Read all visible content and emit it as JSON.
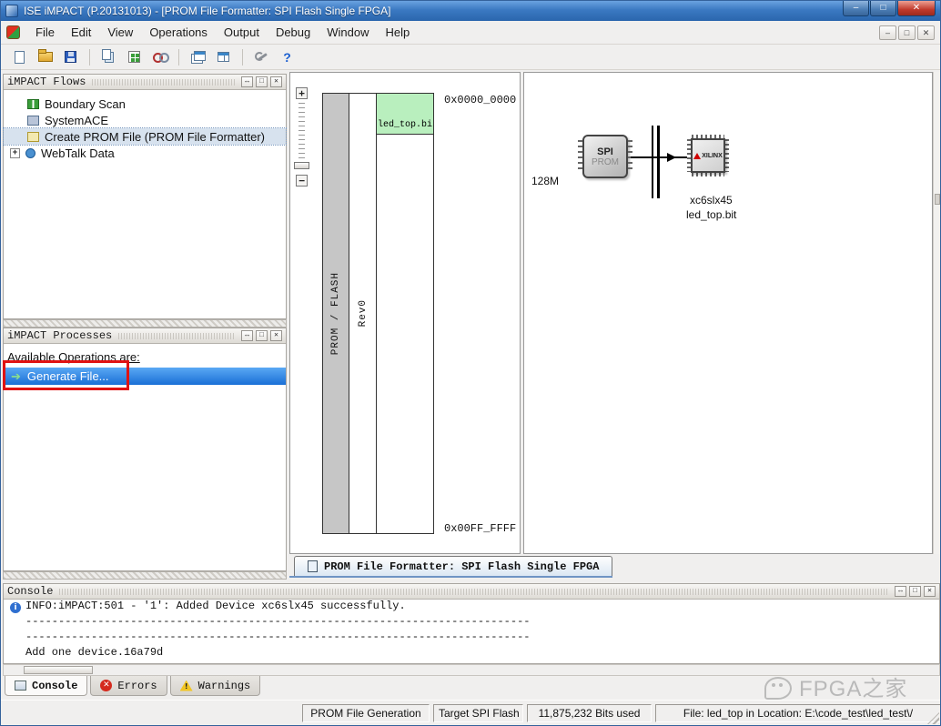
{
  "titlebar": {
    "title": "ISE iMPACT (P.20131013) - [PROM File Formatter: SPI Flash Single FPGA]"
  },
  "menubar": {
    "items": [
      "File",
      "Edit",
      "View",
      "Operations",
      "Output",
      "Debug",
      "Window",
      "Help"
    ]
  },
  "flows_panel": {
    "title": "iMPACT Flows",
    "items": [
      {
        "label": "Boundary Scan"
      },
      {
        "label": "SystemACE"
      },
      {
        "label": "Create PROM File (PROM File Formatter)"
      },
      {
        "label": "WebTalk Data"
      }
    ]
  },
  "processes_panel": {
    "title": "iMPACT Processes",
    "heading": "Available Operations are:",
    "operations": [
      {
        "label": "Generate File..."
      }
    ]
  },
  "prom_view": {
    "flash_label": "PROM / FLASH",
    "rev_label": "Rev0",
    "file_cell": "led_top.bi",
    "address_top": "0x0000_0000",
    "address_bottom": "0x00FF_FFFF",
    "tab_label": "PROM File Formatter: SPI Flash Single FPGA"
  },
  "device_view": {
    "density": "128M",
    "prom_line1": "SPI",
    "prom_line2": "PROM",
    "fpga_brand": "XILINX",
    "fpga_part": "xc6slx45",
    "fpga_file": "led_top.bit"
  },
  "console_panel": {
    "title": "Console",
    "lines": [
      "INFO:iMPACT:501 - '1': Added Device xc6slx45 successfully.",
      "-----------------------------------------------------------------------------",
      "-----------------------------------------------------------------------------",
      "Add one device.16a79d"
    ],
    "tabs": [
      {
        "label": "Console"
      },
      {
        "label": "Errors"
      },
      {
        "label": "Warnings"
      }
    ]
  },
  "statusbar": {
    "fields": [
      "PROM File Generation",
      "Target SPI Flash",
      "11,875,232 Bits used",
      "File: led_top in Location: E:\\code_test\\led_test\\/"
    ]
  },
  "watermark": {
    "text": "FPGA之家"
  }
}
